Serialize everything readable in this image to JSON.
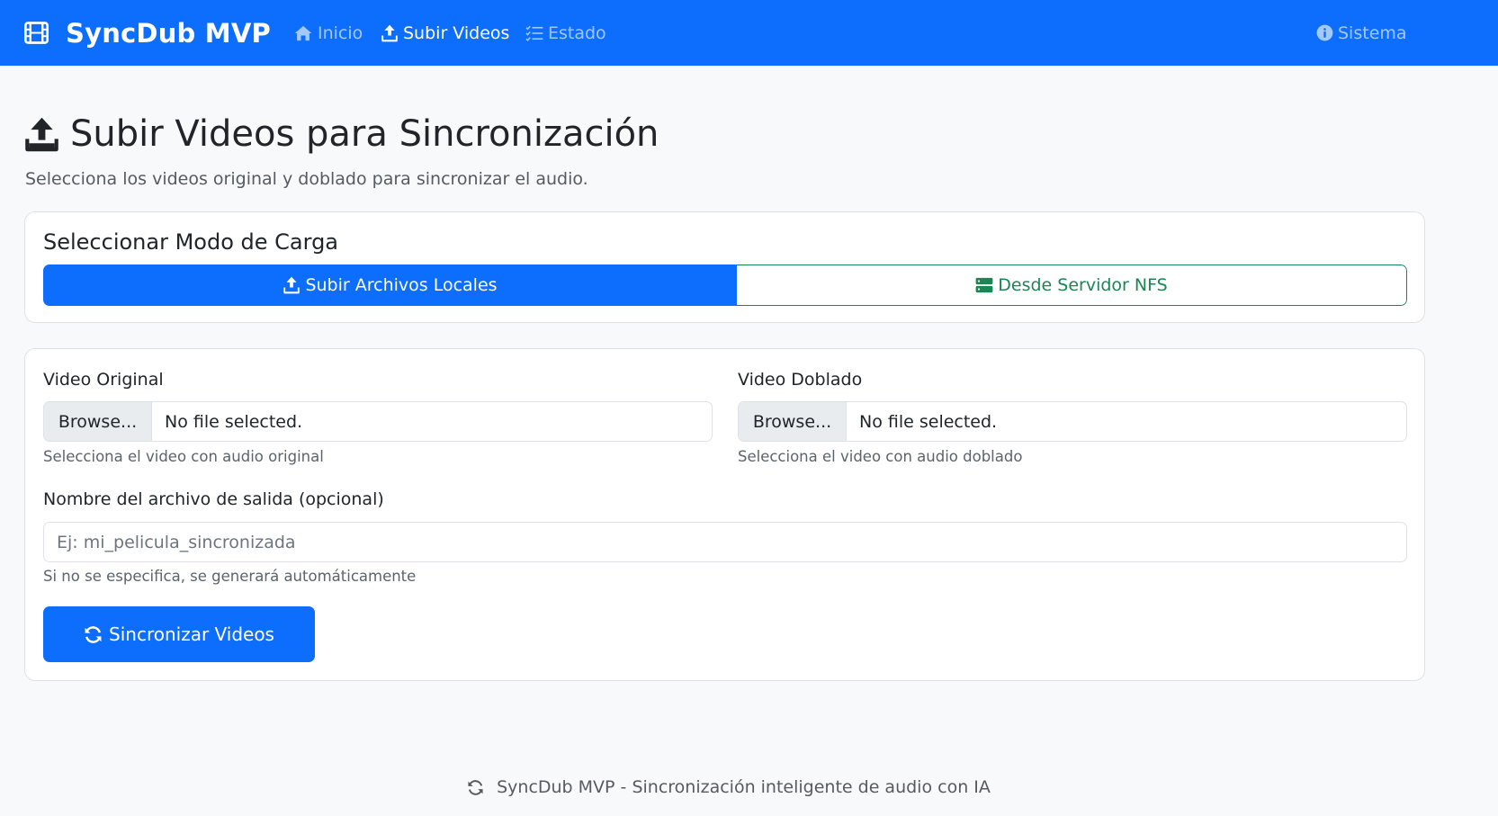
{
  "navbar": {
    "brand": "SyncDub MVP",
    "brand_icon": "film-icon",
    "links": [
      {
        "label": "Inicio",
        "icon": "house-icon",
        "active": false
      },
      {
        "label": "Subir Videos",
        "icon": "upload-icon",
        "active": true
      },
      {
        "label": "Estado",
        "icon": "list-check-icon",
        "active": false
      }
    ],
    "system_label": "Sistema",
    "system_icon": "info-circle-icon"
  },
  "page": {
    "title": "Subir Videos para Sincronización",
    "subtitle": "Selecciona los videos original y doblado para sincronizar el audio."
  },
  "mode_card": {
    "title": "Seleccionar Modo de Carga",
    "local_label": "Subir Archivos Locales",
    "nfs_label": "Desde Servidor NFS",
    "selected": "local"
  },
  "form": {
    "original_label": "Video Original",
    "original_browse": "Browse...",
    "original_file": "No file selected.",
    "original_help": "Selecciona el video con audio original",
    "dubbed_label": "Video Doblado",
    "dubbed_browse": "Browse...",
    "dubbed_file": "No file selected.",
    "dubbed_help": "Selecciona el video con audio doblado",
    "output_label": "Nombre del archivo de salida (opcional)",
    "output_placeholder": "Ej: mi_pelicula_sincronizada",
    "output_value": "",
    "output_help": "Si no se especifica, se generará automáticamente",
    "submit_label": "Sincronizar Videos"
  },
  "footer": {
    "text": "SyncDub MVP - Sincronización inteligente de audio con IA"
  },
  "colors": {
    "primary": "#0d6efd",
    "success": "#198754",
    "background": "#f8f9fa"
  }
}
